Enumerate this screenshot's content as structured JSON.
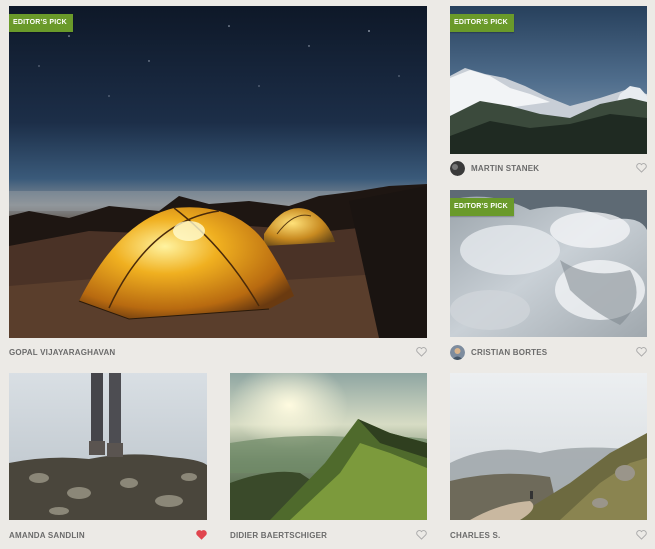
{
  "cards": [
    {
      "author": "GOPAL VIJAYARAGHAVAN",
      "badge": "EDITOR'S PICK",
      "liked": false,
      "has_avatar": false
    },
    {
      "author": "MARTIN STANEK",
      "badge": "EDITOR'S PICK",
      "liked": false,
      "has_avatar": true
    },
    {
      "author": "CRISTIAN BORTES",
      "badge": "EDITOR'S PICK",
      "liked": false,
      "has_avatar": true
    },
    {
      "author": "AMANDA SANDLIN",
      "badge": "",
      "liked": true,
      "has_avatar": false
    },
    {
      "author": "DIDIER BAERTSCHIGER",
      "badge": "",
      "liked": false,
      "has_avatar": false
    },
    {
      "author": "CHARLES S.",
      "badge": "",
      "liked": false,
      "has_avatar": false
    }
  ],
  "colors": {
    "badge": "#6a9a2a",
    "heart_liked": "#e0454e",
    "heart_empty": "#a8a8a8",
    "background": "#eceae6"
  },
  "icons": {
    "like": "heart-icon"
  }
}
